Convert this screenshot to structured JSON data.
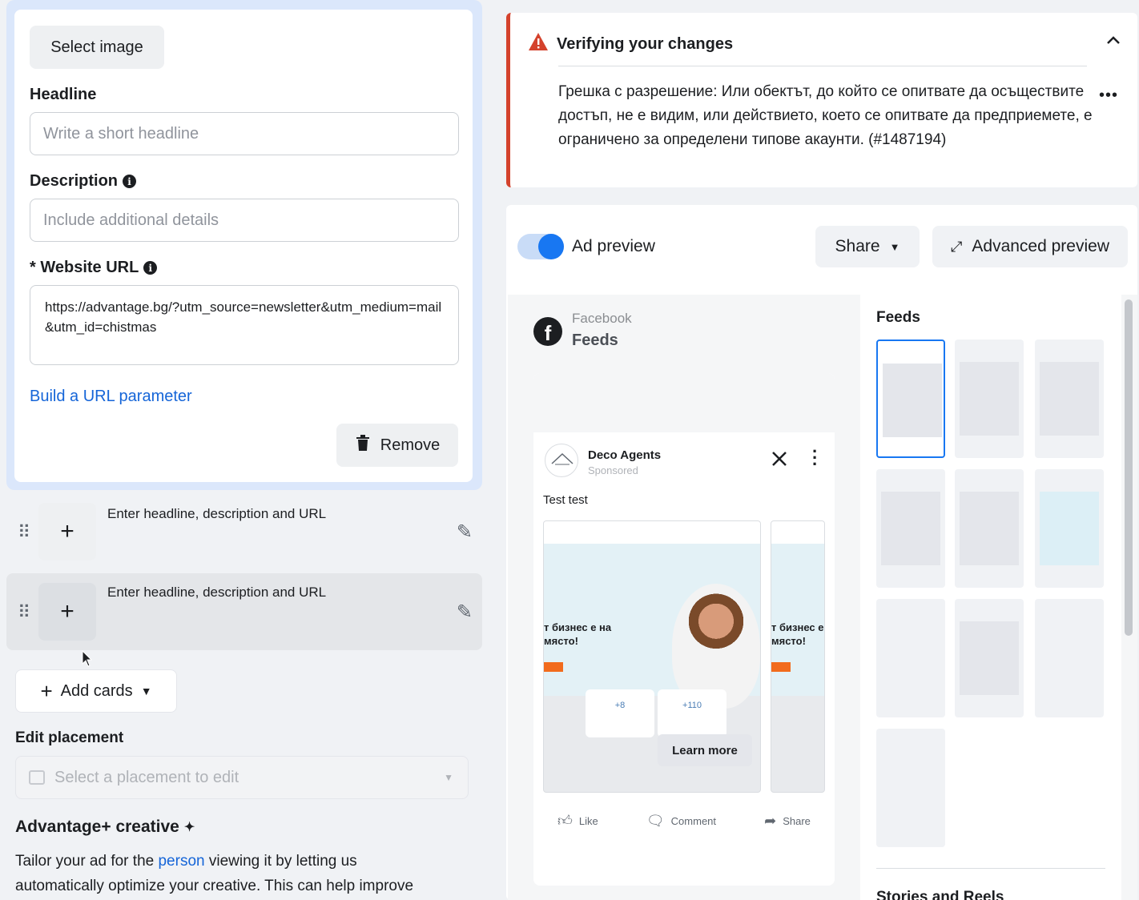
{
  "left": {
    "select_image": "Select image",
    "headline_label": "Headline",
    "headline_placeholder": "Write a short headline",
    "description_label": "Description",
    "description_placeholder": "Include additional details",
    "website_url_label": "* Website URL",
    "website_url_value": "https://advantage.bg/?utm_source=newsletter&utm_medium=mail&utm_id=chistmas",
    "build_url_link": "Build a URL parameter",
    "remove_label": "Remove",
    "card_rows": [
      {
        "text": "Enter headline, description and URL"
      },
      {
        "text": "Enter headline, description and URL"
      }
    ],
    "add_cards": "Add cards",
    "edit_placement_label": "Edit placement",
    "placement_placeholder": "Select a placement to edit",
    "advantage_title": "Advantage+ creative",
    "advantage_text_1": "Tailor your ad for the ",
    "advantage_link": "person",
    "advantage_text_2": " viewing it by letting us",
    "advantage_text_3": "automatically optimize your creative. This can help improve"
  },
  "alert": {
    "title": "Verifying your changes",
    "body": "Грешка с разрешение: Или обектът, до който се опитвате да осъществите достъп, не е видим, или действието, което се опитвате да предприемете, е ограничено за определени типове акаунти. (#1487194)"
  },
  "preview": {
    "toggle_label": "Ad preview",
    "share": "Share",
    "advanced_preview": "Advanced preview",
    "platform": "Facebook",
    "placement": "Feeds",
    "page_name": "Deco Agents",
    "sponsored": "Sponsored",
    "post_text": "Test test",
    "hero_text": "т бизнес е на\nмясто!",
    "stats": [
      "+8",
      "+110"
    ],
    "learn_more": "Learn more",
    "like": "Like",
    "comment": "Comment",
    "share_action": "Share",
    "feeds_title": "Feeds",
    "stories_title": "Stories and Reels"
  },
  "colors": {
    "accent": "#1877f2",
    "error": "#d4422c",
    "link": "#1565d8"
  }
}
